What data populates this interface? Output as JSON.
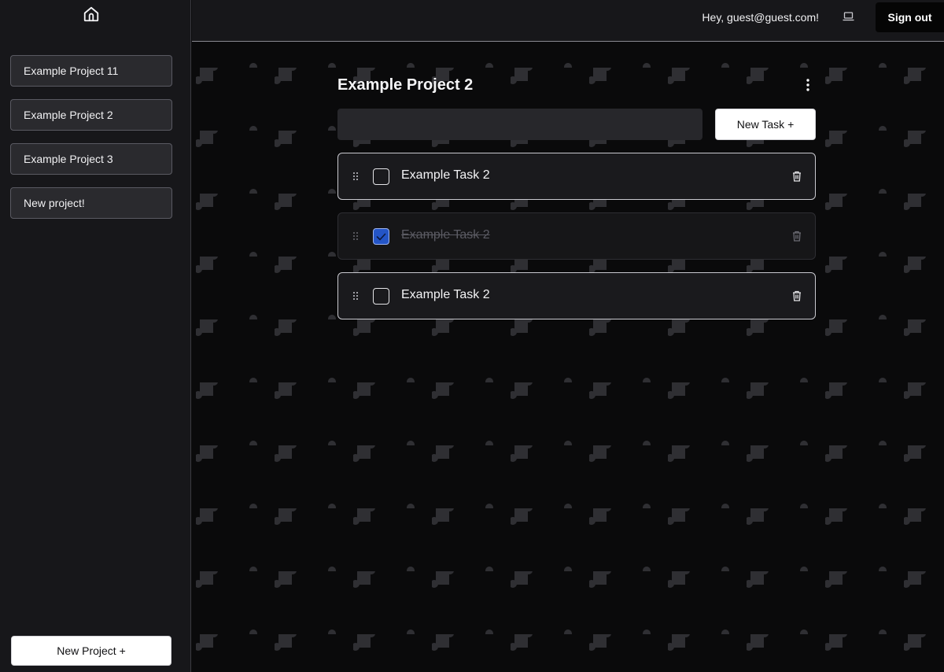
{
  "sidebar": {
    "home_icon": "home-icon",
    "projects": [
      {
        "label": "Example Project 11"
      },
      {
        "label": "Example Project 2"
      },
      {
        "label": "Example Project 3"
      },
      {
        "label": "New project!"
      }
    ],
    "new_project_label": "New Project +"
  },
  "header": {
    "greeting": "Hey, guest@guest.com!",
    "theme_icon": "laptop-icon",
    "signout_label": "Sign out"
  },
  "main": {
    "project_title": "Example Project 2",
    "menu_icon": "more-vertical-icon",
    "task_input": {
      "value": "",
      "placeholder": ""
    },
    "new_task_label": "New Task +",
    "tasks": [
      {
        "label": "Example Task 2",
        "completed": false
      },
      {
        "label": "Example Task 2",
        "completed": true
      },
      {
        "label": "Example Task 2",
        "completed": false
      }
    ]
  },
  "colors": {
    "sidebar_bg": "#17171a",
    "main_bg": "#0a0a0b",
    "checked_accent": "#2455c7",
    "primary_button": "#ffffff"
  }
}
